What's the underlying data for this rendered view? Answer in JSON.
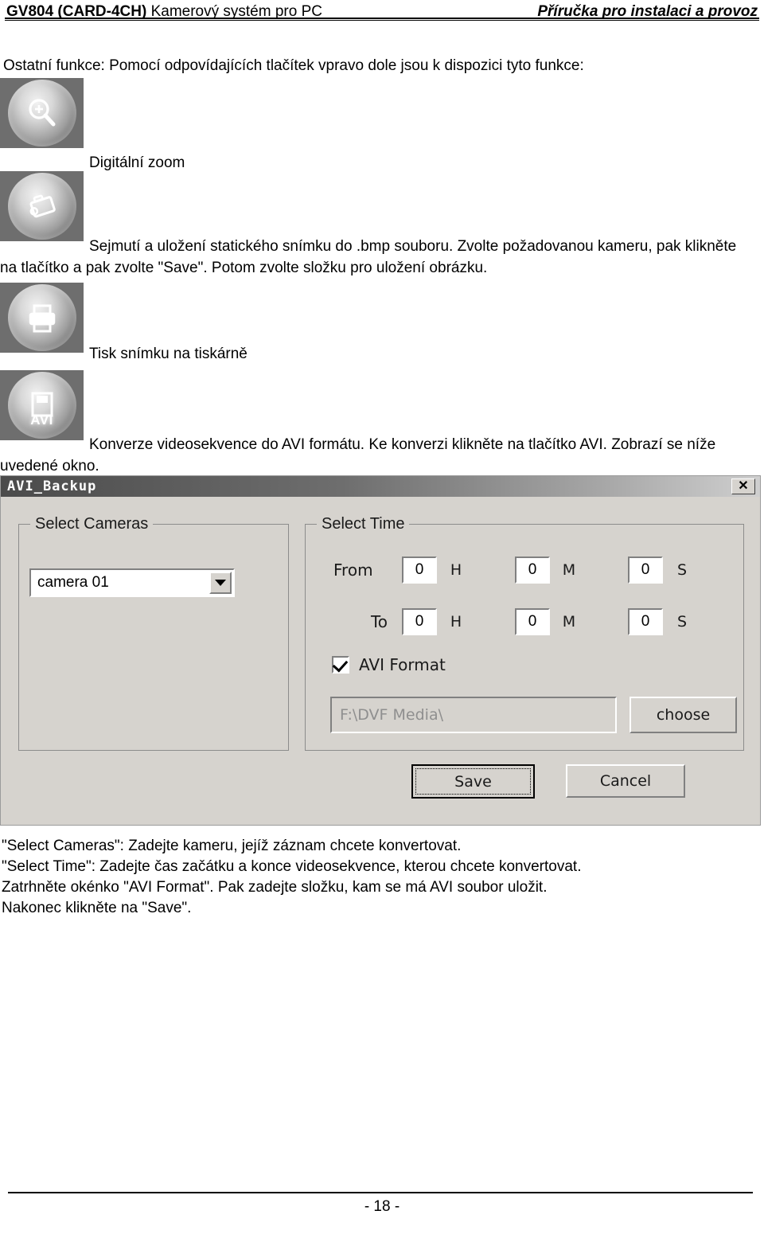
{
  "header": {
    "left_bold": "GV804 (CARD-4CH)",
    "left_rest": " Kamerový systém pro PC",
    "right": "Příručka pro instalaci a provoz"
  },
  "intro": "Ostatní funkce: Pomocí odpovídajících tlačítek vpravo dole jsou k dispozici tyto funkce:",
  "features": {
    "zoom_caption": "Digitální zoom",
    "snapshot_paragraph": "Sejmutí a uložení statického snímku do .bmp souboru. Zvolte požadovanou kameru, pak klikněte na tlačítko a pak zvolte \"Save\". Potom zvolte složku pro uložení obrázku.",
    "print_caption": "Tisk snímku na tiskárně",
    "avi_paragraph": "Konverze videosekvence do AVI formátu. Ke konverzi klikněte na tlačítko AVI. Zobrazí se níže uvedené okno.",
    "avi_icon_text": "AVI"
  },
  "dialog": {
    "title": "AVI_Backup",
    "close_label": "✕",
    "cameras_group": {
      "legend": "Select Cameras",
      "selected_camera": "camera 01"
    },
    "time_group": {
      "legend": "Select Time",
      "from_label": "From",
      "to_label": "To",
      "unit_hour": "H",
      "unit_minute": "M",
      "unit_second": "S",
      "from_hour": "0",
      "from_minute": "0",
      "from_second": "0",
      "to_hour": "0",
      "to_minute": "0",
      "to_second": "0"
    },
    "avi_format_label": "AVI Format",
    "avi_format_checked": true,
    "path_value": "F:\\DVF Media\\",
    "choose_label": "choose",
    "save_label": "Save",
    "cancel_label": "Cancel"
  },
  "notes": [
    "\"Select Cameras\": Zadejte kameru, jejíž záznam chcete konvertovat.",
    "\"Select Time\": Zadejte čas začátku a konce videosekvence, kterou chcete konvertovat.",
    "Zatrhněte okénko \"AVI Format\". Pak zadejte složku, kam se má AVI soubor uložit.",
    "Nakonec klikněte na \"Save\"."
  ],
  "footer": {
    "page_number": "- 18 -"
  }
}
